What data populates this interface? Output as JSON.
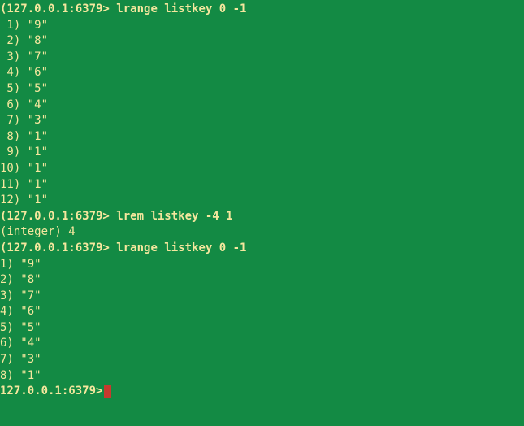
{
  "blocks": [
    {
      "type": "command",
      "prompt": "(127.0.0.1:6379>",
      "command": "lrange listkey 0 -1"
    },
    {
      "type": "list",
      "items": [
        {
          "index": " 1)",
          "value": "\"9\""
        },
        {
          "index": " 2)",
          "value": "\"8\""
        },
        {
          "index": " 3)",
          "value": "\"7\""
        },
        {
          "index": " 4)",
          "value": "\"6\""
        },
        {
          "index": " 5)",
          "value": "\"5\""
        },
        {
          "index": " 6)",
          "value": "\"4\""
        },
        {
          "index": " 7)",
          "value": "\"3\""
        },
        {
          "index": " 8)",
          "value": "\"1\""
        },
        {
          "index": " 9)",
          "value": "\"1\""
        },
        {
          "index": "10)",
          "value": "\"1\""
        },
        {
          "index": "11)",
          "value": "\"1\""
        },
        {
          "index": "12)",
          "value": "\"1\""
        }
      ]
    },
    {
      "type": "command",
      "prompt": "(127.0.0.1:6379>",
      "command": "lrem listkey -4 1"
    },
    {
      "type": "integer",
      "text": "(integer) 4"
    },
    {
      "type": "command",
      "prompt": "(127.0.0.1:6379>",
      "command": "lrange listkey 0 -1"
    },
    {
      "type": "list",
      "items": [
        {
          "index": "1)",
          "value": "\"9\""
        },
        {
          "index": "2)",
          "value": "\"8\""
        },
        {
          "index": "3)",
          "value": "\"7\""
        },
        {
          "index": "4)",
          "value": "\"6\""
        },
        {
          "index": "5)",
          "value": "\"5\""
        },
        {
          "index": "6)",
          "value": "\"4\""
        },
        {
          "index": "7)",
          "value": "\"3\""
        },
        {
          "index": "8)",
          "value": "\"1\""
        }
      ]
    },
    {
      "type": "prompt-only",
      "prompt": "127.0.0.1:6379>"
    }
  ]
}
